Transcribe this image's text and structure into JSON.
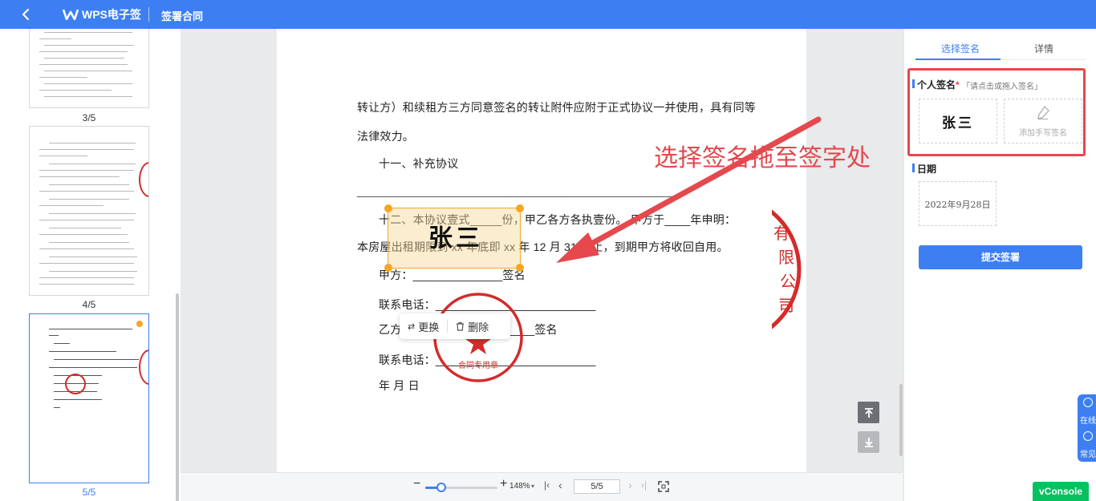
{
  "header": {
    "app_name": "WPS电子签",
    "page_title": "签署合同"
  },
  "thumbnails": [
    {
      "label": "3/5",
      "active": false
    },
    {
      "label": "4/5",
      "active": false
    },
    {
      "label": "5/5",
      "active": true
    }
  ],
  "document": {
    "lines": [
      "转让方）和续租方三方同意签名的转让附件应附于正式协议一并使用，具有同等",
      "法律效力。",
      "十一、补充协议",
      "__________________________________________________",
      "十二、本协议壹式_____份，甲乙各方各执壹份。  甲方于____年申明：",
      "本房屋出租期限到 xx 年底即 xx 年 12 月 31 日止，到期甲方将收回自用。",
      "甲方：______________签名",
      "联系电话：_________________________",
      "乙方：___________________签名",
      "联系电话：_________________________",
      "年  月  日"
    ],
    "drag_hint": "选择签名拖至签字处",
    "placed_signature": "张三",
    "stamp_text": "合同专用章",
    "stamp_arc_text": "有限公司",
    "popup": {
      "replace": "更换",
      "delete": "删除"
    }
  },
  "toolbar": {
    "zoom": "148%",
    "zoom_fraction": 0.22,
    "page_input": "5/5"
  },
  "right_panel": {
    "tabs": [
      "选择签名",
      "详情"
    ],
    "active_tab": "选择签名",
    "personal_sig_title": "个人签名",
    "required_mark": "*",
    "personal_sig_hint": "「请点击或拖入签名」",
    "saved_signature": "张三",
    "add_handwritten": "添加手写签名",
    "date_title": "日期",
    "date_value": "2022年9月28日",
    "submit_label": "提交签署"
  },
  "floating": {
    "online": "在线",
    "faq": "常见"
  },
  "vconsole": "vConsole",
  "colors": {
    "accent": "#3d7ff2",
    "alert": "#e5484d",
    "seal": "#d42b2b",
    "handle": "#f5a623"
  }
}
